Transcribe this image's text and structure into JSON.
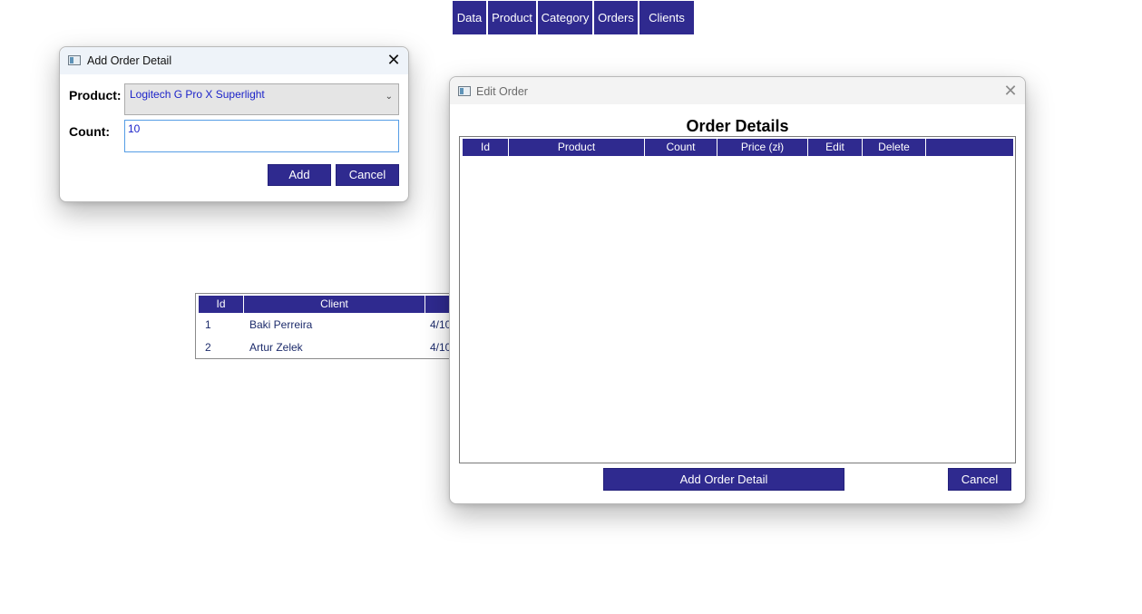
{
  "menu": {
    "items": [
      {
        "label": "Data"
      },
      {
        "label": "Product"
      },
      {
        "label": "Category"
      },
      {
        "label": "Orders"
      },
      {
        "label": "Clients"
      }
    ]
  },
  "orders_table": {
    "columns": [
      "Id",
      "Client"
    ],
    "rows": [
      {
        "id": "1",
        "client": "Baki Perreira",
        "date": "4/10"
      },
      {
        "id": "2",
        "client": "Artur Zelek",
        "date": "4/10"
      }
    ]
  },
  "add_dialog": {
    "title": "Add Order Detail",
    "product_label": "Product:",
    "product_value": "Logitech G Pro X Superlight",
    "count_label": "Count:",
    "count_value": "10",
    "add_label": "Add",
    "cancel_label": "Cancel"
  },
  "edit_dialog": {
    "title": "Edit Order",
    "heading": "Order Details",
    "columns": [
      "Id",
      "Product",
      "Count",
      "Price (zł)",
      "Edit",
      "Delete"
    ],
    "add_detail_label": "Add Order Detail",
    "cancel_label": "Cancel"
  },
  "colors": {
    "accent": "#2f2a8f",
    "input_text": "#1c23c9"
  },
  "icons": {
    "window": "app-window-icon",
    "close": "close-icon",
    "dropdown": "chevron-down-icon"
  }
}
